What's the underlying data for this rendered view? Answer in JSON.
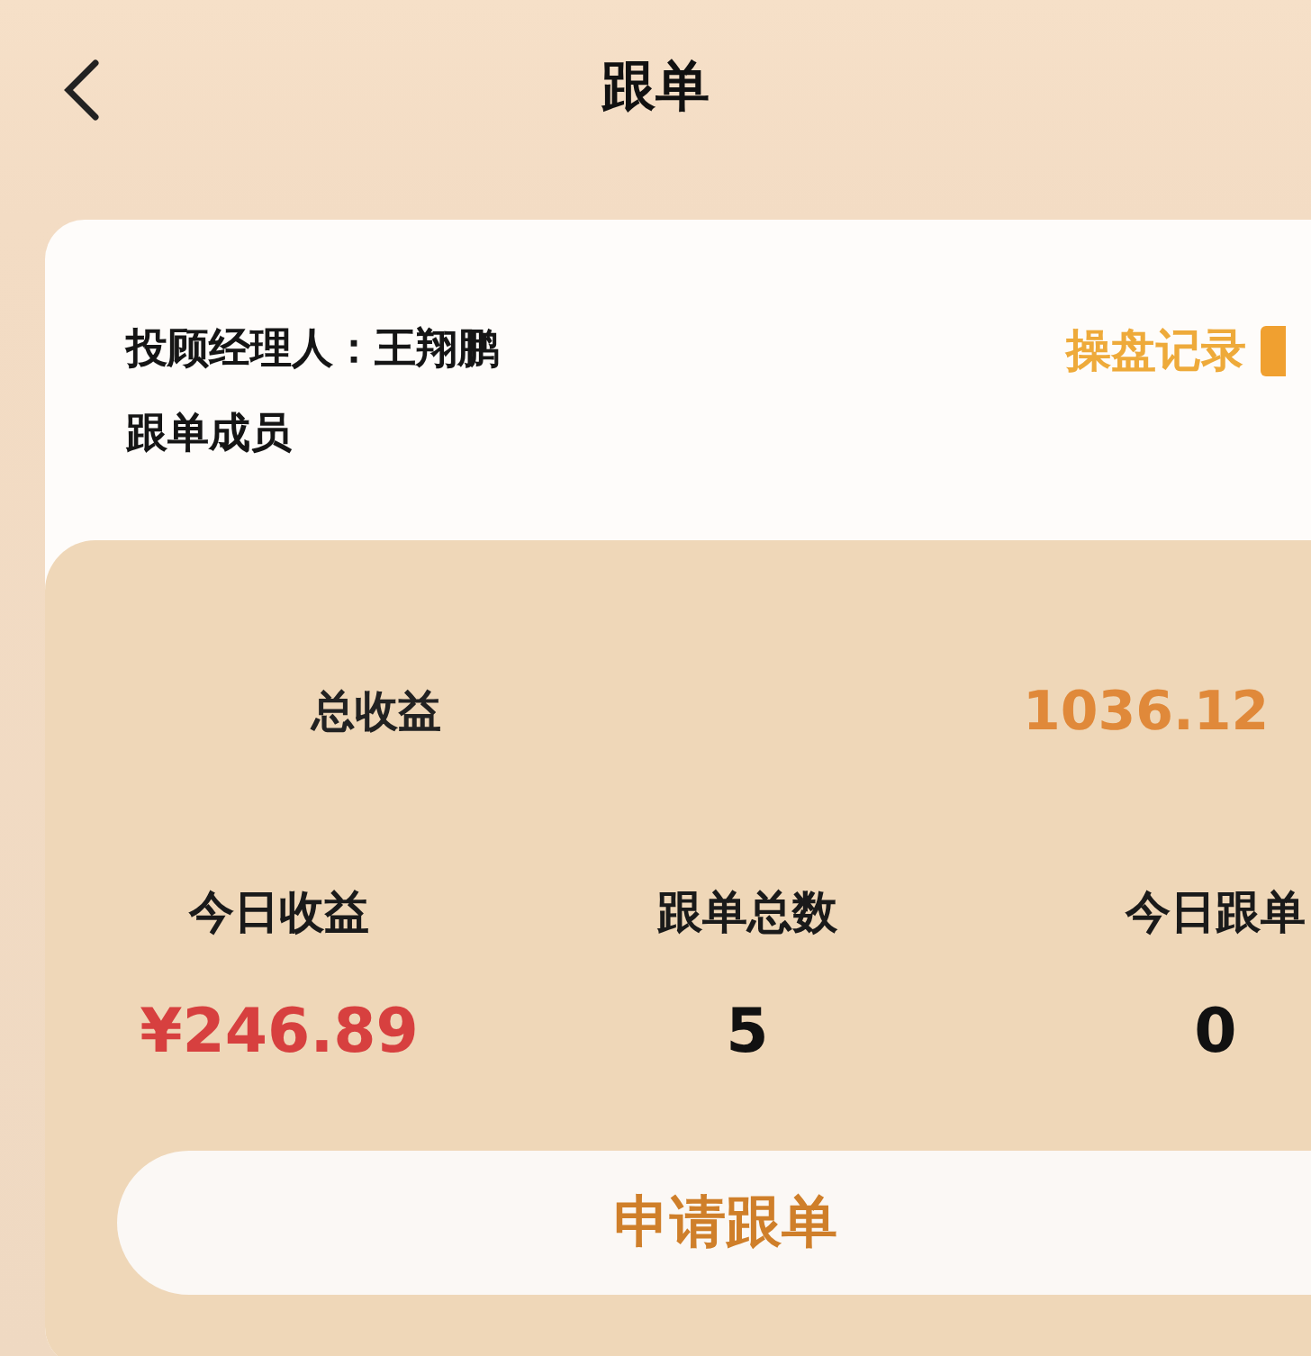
{
  "header": {
    "title": "跟单"
  },
  "manager": {
    "label": "投顾经理人：王翔鹏",
    "link": "操盘记录"
  },
  "members_label": "跟单成员",
  "total": {
    "label": "总收益",
    "value": "1036.12"
  },
  "stats": [
    {
      "label": "今日收益",
      "value": "¥246.89",
      "kind": "money"
    },
    {
      "label": "跟单总数",
      "value": "5",
      "kind": "count"
    },
    {
      "label": "今日跟单",
      "value": "0",
      "kind": "count"
    }
  ],
  "apply_button": "申请跟单"
}
